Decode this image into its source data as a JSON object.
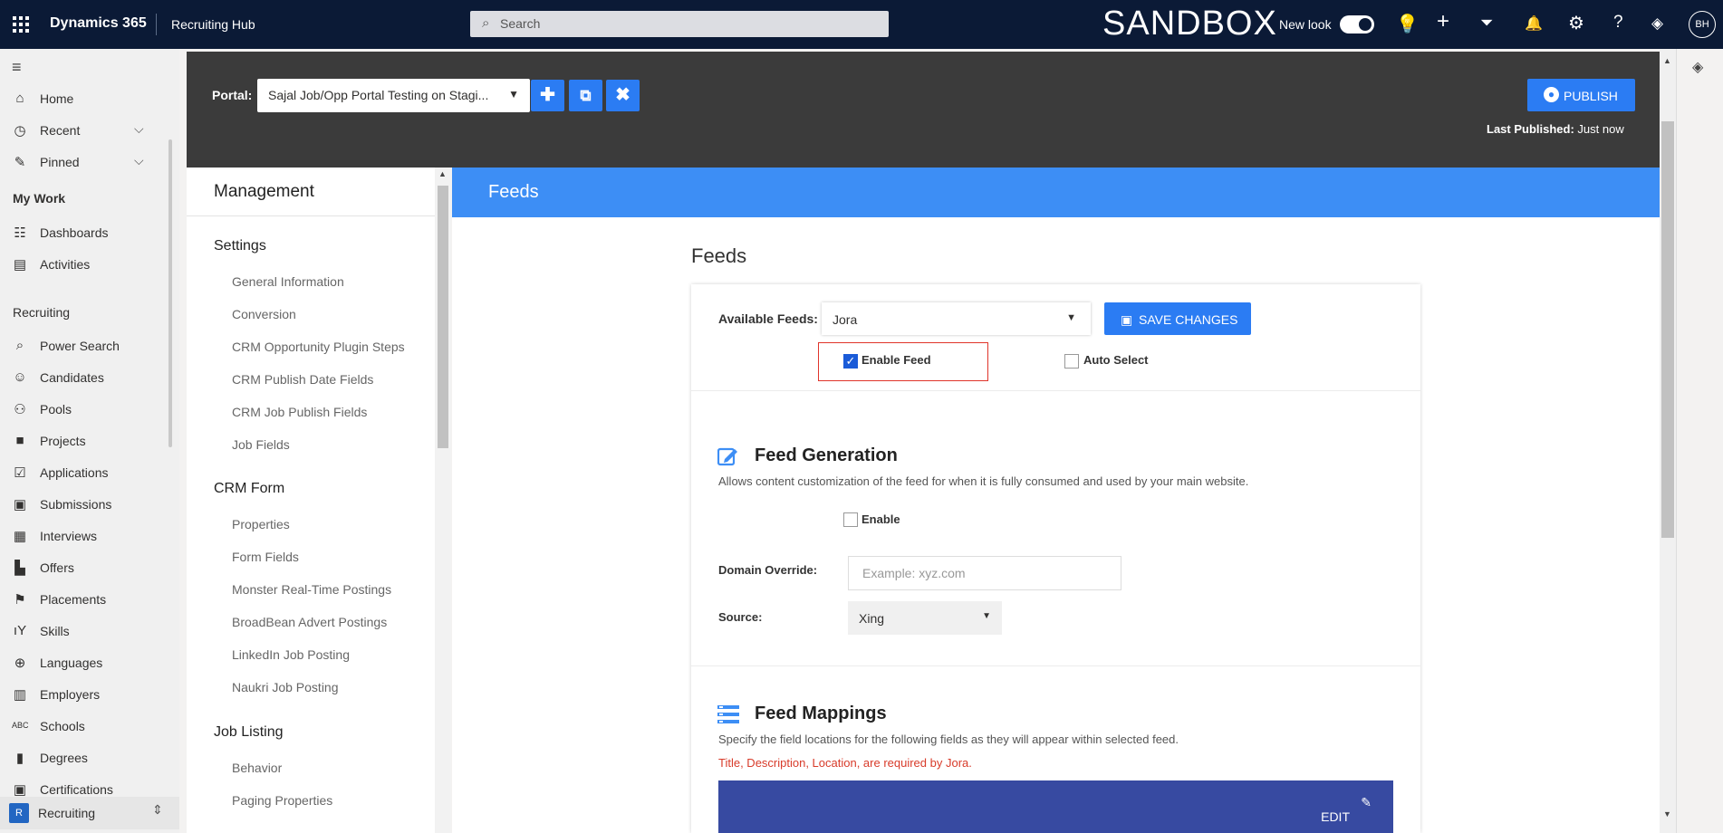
{
  "topbar": {
    "app_name": "Dynamics 365",
    "area_name": "Recruiting Hub",
    "search_placeholder": "Search",
    "env_label": "SANDBOX",
    "new_look_label": "New look",
    "new_look_on": true,
    "avatar_initials": "BH"
  },
  "nav": {
    "items_top": [
      {
        "label": "Home",
        "icon": "home-icon"
      },
      {
        "label": "Recent",
        "icon": "clock-icon"
      },
      {
        "label": "Pinned",
        "icon": "pin-icon"
      }
    ],
    "my_work_heading": "My Work",
    "my_work": [
      {
        "label": "Dashboards",
        "icon": "dashboard-icon"
      },
      {
        "label": "Activities",
        "icon": "clipboard-icon"
      }
    ],
    "recruiting_heading": "Recruiting",
    "recruiting": [
      {
        "label": "Power Search",
        "icon": "search-icon"
      },
      {
        "label": "Candidates",
        "icon": "person-icon"
      },
      {
        "label": "Pools",
        "icon": "group-icon"
      },
      {
        "label": "Projects",
        "icon": "briefcase-icon"
      },
      {
        "label": "Applications",
        "icon": "check-doc-icon"
      },
      {
        "label": "Submissions",
        "icon": "card-icon"
      },
      {
        "label": "Interviews",
        "icon": "calendar-icon"
      },
      {
        "label": "Offers",
        "icon": "offer-icon"
      },
      {
        "label": "Placements",
        "icon": "placement-icon"
      },
      {
        "label": "Skills",
        "icon": "skills-icon"
      },
      {
        "label": "Languages",
        "icon": "globe-icon"
      },
      {
        "label": "Employers",
        "icon": "building-icon"
      },
      {
        "label": "Schools",
        "icon": "abc-icon"
      },
      {
        "label": "Degrees",
        "icon": "book-icon"
      },
      {
        "label": "Certifications",
        "icon": "certificate-icon"
      }
    ],
    "footer_badge": "R",
    "footer_label": "Recruiting"
  },
  "portal": {
    "label": "Portal:",
    "selected": "Sajal Job/Opp Portal Testing on Stagi...",
    "publish_label": "PUBLISH",
    "last_published_label": "Last Published:",
    "last_published_value": "Just now"
  },
  "management": {
    "title": "Management",
    "sections": [
      {
        "heading": "Settings",
        "items": [
          "General Information",
          "Conversion",
          "CRM Opportunity Plugin Steps",
          "CRM Publish Date Fields",
          "CRM Job Publish Fields",
          "Job Fields"
        ]
      },
      {
        "heading": "CRM Form",
        "items": [
          "Properties",
          "Form Fields",
          "Monster Real-Time Postings",
          "BroadBean Advert Postings",
          "LinkedIn Job Posting",
          "Naukri Job Posting"
        ]
      },
      {
        "heading": "Job Listing",
        "items": [
          "Behavior",
          "Paging Properties"
        ]
      }
    ]
  },
  "feeds": {
    "banner": "Feeds",
    "heading": "Feeds",
    "available_label": "Available Feeds:",
    "available_value": "Jora",
    "save_label": "SAVE CHANGES",
    "enable_feed_label": "Enable Feed",
    "enable_feed_checked": true,
    "auto_select_label": "Auto Select",
    "auto_select_checked": false,
    "generation": {
      "title": "Feed Generation",
      "description": "Allows content customization of the feed for when it is fully consumed and used by your main website.",
      "enable_label": "Enable",
      "enable_checked": false,
      "domain_label": "Domain Override:",
      "domain_placeholder": "Example: xyz.com",
      "source_label": "Source:",
      "source_value": "Xing"
    },
    "mappings": {
      "title": "Feed Mappings",
      "description": "Specify the field locations for the following fields as they will appear within selected feed.",
      "required_note": "Title, Description, Location, are required by Jora.",
      "edit_label": "EDIT"
    }
  },
  "colors": {
    "topbar": "#0b1a36",
    "accent": "#2b7cf3",
    "banner": "#3d8ef5",
    "portal_bar": "#3b3b3b",
    "edit_bar": "#374aa1",
    "required_text": "#d83b2a",
    "highlight_box": "#e0342a"
  }
}
